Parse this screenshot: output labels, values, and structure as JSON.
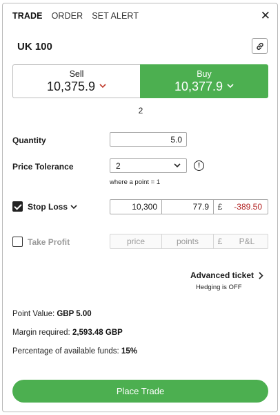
{
  "tabs": [
    {
      "label": "TRADE",
      "active": true
    },
    {
      "label": "ORDER",
      "active": false
    },
    {
      "label": "SET ALERT",
      "active": false
    }
  ],
  "close_glyph": "✕",
  "instrument": "UK 100",
  "sell": {
    "label": "Sell",
    "price": "10,375.9"
  },
  "buy": {
    "label": "Buy",
    "price": "10,377.9"
  },
  "spread": "2",
  "quantity": {
    "label": "Quantity",
    "value": "5.0"
  },
  "price_tolerance": {
    "label": "Price Tolerance",
    "value": "2",
    "hint": "where a point = 1"
  },
  "stop_loss": {
    "label": "Stop Loss",
    "checked": true,
    "price": "10,300",
    "points": "77.9",
    "currency": "£",
    "pnl": "-389.50"
  },
  "take_profit": {
    "label": "Take Profit",
    "checked": false,
    "price_placeholder": "price",
    "points_placeholder": "points",
    "currency": "£",
    "pnl_placeholder": "P&L"
  },
  "advanced": {
    "label": "Advanced ticket",
    "hedging": "Hedging is OFF"
  },
  "point_value": {
    "label": "Point Value:",
    "value": "GBP 5.00"
  },
  "margin": {
    "label": "Margin required:",
    "value": "2,593.48 GBP"
  },
  "funds": {
    "label": "Percentage of available funds:",
    "value": "15%"
  },
  "place_trade": "Place Trade",
  "colors": {
    "accent_green": "#4caf50",
    "loss_red": "#b22222"
  },
  "icons": [
    "close-icon",
    "link-icon",
    "chevron-down-icon",
    "info-icon",
    "chevron-right-icon",
    "checkbox-check-icon"
  ]
}
